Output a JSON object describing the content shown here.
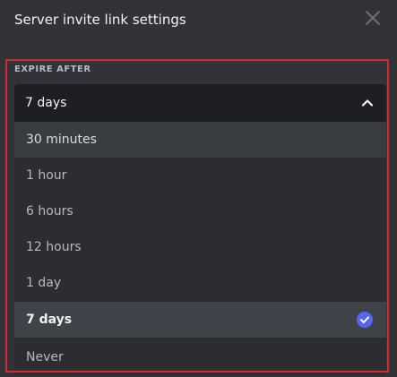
{
  "dialog": {
    "title": "Server invite link settings",
    "close_icon": "close-icon"
  },
  "expire_after": {
    "label": "EXPIRE AFTER",
    "selected_value": "7 days",
    "chevron_icon": "chevron-up-icon",
    "options": [
      {
        "label": "30 minutes",
        "state": "hover"
      },
      {
        "label": "1 hour",
        "state": "normal"
      },
      {
        "label": "6 hours",
        "state": "normal"
      },
      {
        "label": "12 hours",
        "state": "normal"
      },
      {
        "label": "1 day",
        "state": "normal"
      },
      {
        "label": "7 days",
        "state": "selected"
      },
      {
        "label": "Never",
        "state": "normal"
      }
    ],
    "check_icon": "check-circle-icon"
  },
  "colors": {
    "background": "#313338",
    "select_background": "#1e1f22",
    "menu_background": "#2b2d31",
    "selected_background": "#404249",
    "accent": "#5865f2",
    "highlight_border": "#d42a2f"
  }
}
